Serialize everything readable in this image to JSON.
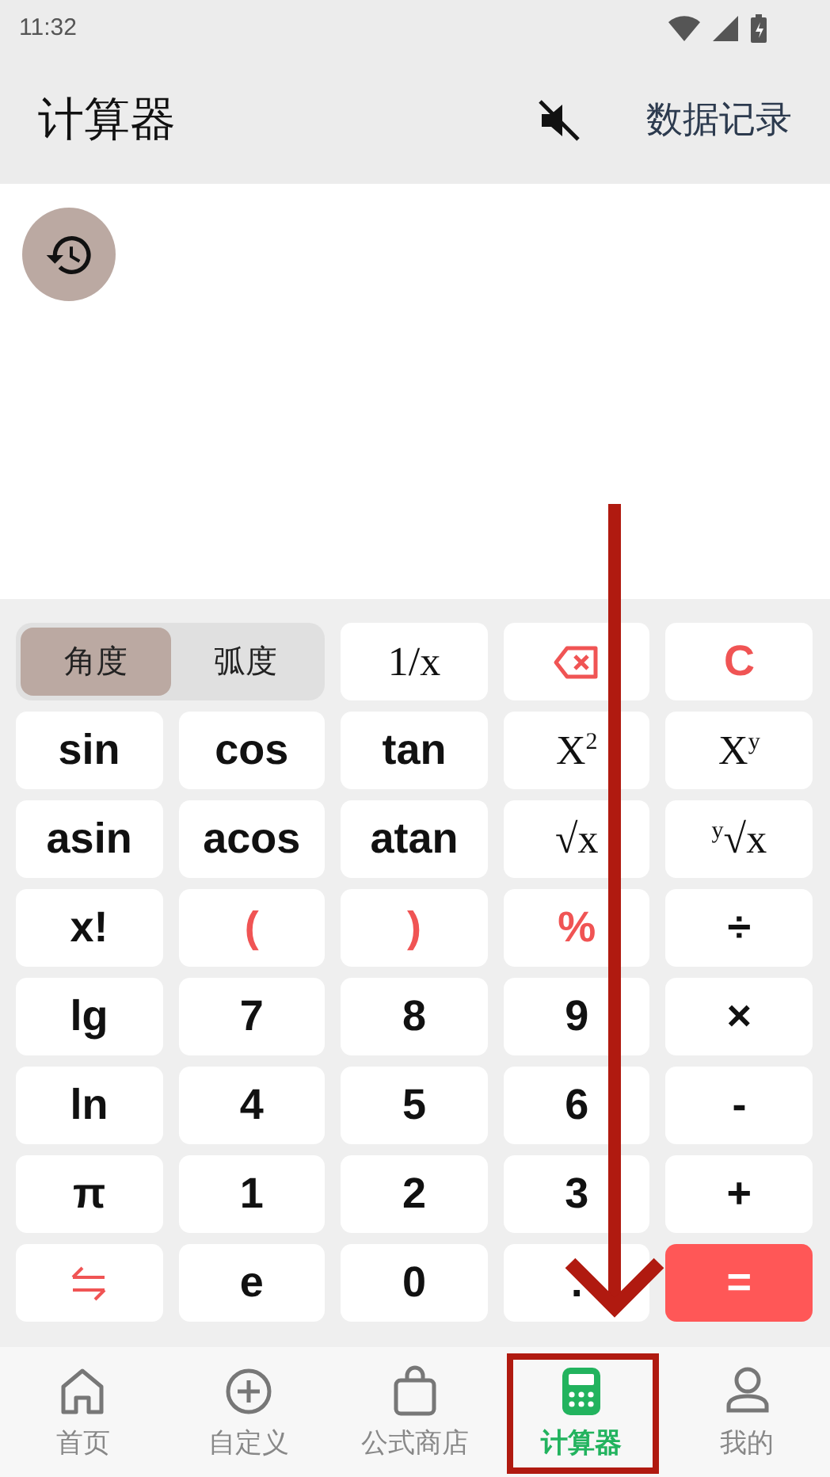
{
  "status_bar": {
    "time": "11:32"
  },
  "header": {
    "title": "计算器",
    "link": "数据记录",
    "muted": true
  },
  "angle_mode": [
    {
      "label": "角度",
      "selected": true
    },
    {
      "label": "弧度",
      "selected": false
    }
  ],
  "keys": [
    {
      "kind": "math",
      "label": "1/x",
      "accent": false
    },
    {
      "kind": "backspace",
      "accent": true
    },
    {
      "kind": "text",
      "label": "C",
      "accent": true
    },
    {
      "kind": "text",
      "label": "sin",
      "accent": false
    },
    {
      "kind": "text",
      "label": "cos",
      "accent": false
    },
    {
      "kind": "text",
      "label": "tan",
      "accent": false
    },
    {
      "kind": "math",
      "label": "X$^{2}$",
      "accent": false
    },
    {
      "kind": "math",
      "label": "X$^{y}$",
      "accent": false
    },
    {
      "kind": "text",
      "label": "asin",
      "accent": false
    },
    {
      "kind": "text",
      "label": "acos",
      "accent": false
    },
    {
      "kind": "text",
      "label": "atan",
      "accent": false
    },
    {
      "kind": "math",
      "label": "√x",
      "accent": false
    },
    {
      "kind": "math",
      "label": "$^{y}$√x",
      "accent": false
    },
    {
      "kind": "text",
      "label": "x!",
      "accent": false
    },
    {
      "kind": "text",
      "label": "(",
      "accent": true
    },
    {
      "kind": "text",
      "label": ")",
      "accent": true
    },
    {
      "kind": "text",
      "label": "%",
      "accent": true
    },
    {
      "kind": "text",
      "label": "÷",
      "accent": false
    },
    {
      "kind": "text",
      "label": "lg",
      "accent": false
    },
    {
      "kind": "text",
      "label": "7",
      "accent": false
    },
    {
      "kind": "text",
      "label": "8",
      "accent": false
    },
    {
      "kind": "text",
      "label": "9",
      "accent": false
    },
    {
      "kind": "text",
      "label": "×",
      "accent": false
    },
    {
      "kind": "text",
      "label": "ln",
      "accent": false
    },
    {
      "kind": "text",
      "label": "4",
      "accent": false
    },
    {
      "kind": "text",
      "label": "5",
      "accent": false
    },
    {
      "kind": "text",
      "label": "6",
      "accent": false
    },
    {
      "kind": "text",
      "label": "-",
      "accent": false
    },
    {
      "kind": "text",
      "label": "π",
      "accent": false
    },
    {
      "kind": "text",
      "label": "1",
      "accent": false
    },
    {
      "kind": "text",
      "label": "2",
      "accent": false
    },
    {
      "kind": "text",
      "label": "3",
      "accent": false
    },
    {
      "kind": "text",
      "label": "+",
      "accent": false
    },
    {
      "kind": "swap",
      "accent": true
    },
    {
      "kind": "text",
      "label": "e",
      "accent": false
    },
    {
      "kind": "text",
      "label": "0",
      "accent": false
    },
    {
      "kind": "text",
      "label": ".",
      "accent": false
    },
    {
      "kind": "equals",
      "label": "=",
      "accent": true
    }
  ],
  "tab_bar": [
    {
      "kind": "home",
      "label": "首页",
      "selected": false
    },
    {
      "kind": "add",
      "label": "自定义",
      "selected": false
    },
    {
      "kind": "bag",
      "label": "公式商店",
      "selected": false
    },
    {
      "kind": "calc",
      "label": "计算器",
      "selected": true
    },
    {
      "kind": "profile",
      "label": "我的",
      "selected": false
    }
  ]
}
